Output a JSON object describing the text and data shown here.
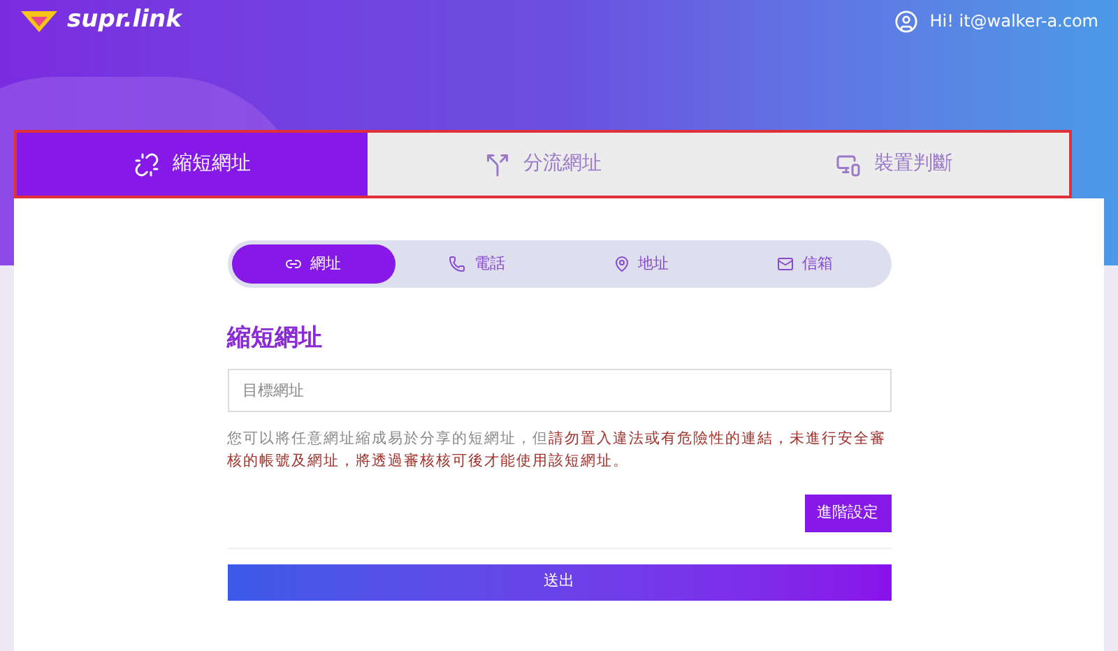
{
  "header": {
    "logo_text": "supr.link",
    "greeting": "Hi! it@walker-a.com"
  },
  "tabs": [
    {
      "label": "縮短網址",
      "selected": true,
      "kind": "shorten"
    },
    {
      "label": "分流網址",
      "selected": false,
      "kind": "split"
    },
    {
      "label": "裝置判斷",
      "selected": false,
      "kind": "device"
    }
  ],
  "segments": [
    {
      "label": "網址",
      "selected": true,
      "kind": "link"
    },
    {
      "label": "電話",
      "selected": false,
      "kind": "phone"
    },
    {
      "label": "地址",
      "selected": false,
      "kind": "address"
    },
    {
      "label": "信箱",
      "selected": false,
      "kind": "mail"
    }
  ],
  "form": {
    "heading": "縮短網址",
    "url_field": {
      "placeholder": "目標網址"
    },
    "notice": {
      "text": "您可以將任意網址縮成易於分享的短網址，但",
      "warning": "請勿置入違法或有危險性的連結，未進行安全審核的帳號及網址，將透過審核核可後才能使用該短網址。"
    },
    "advanced_button": "進階設定",
    "submit_button": "送出"
  }
}
